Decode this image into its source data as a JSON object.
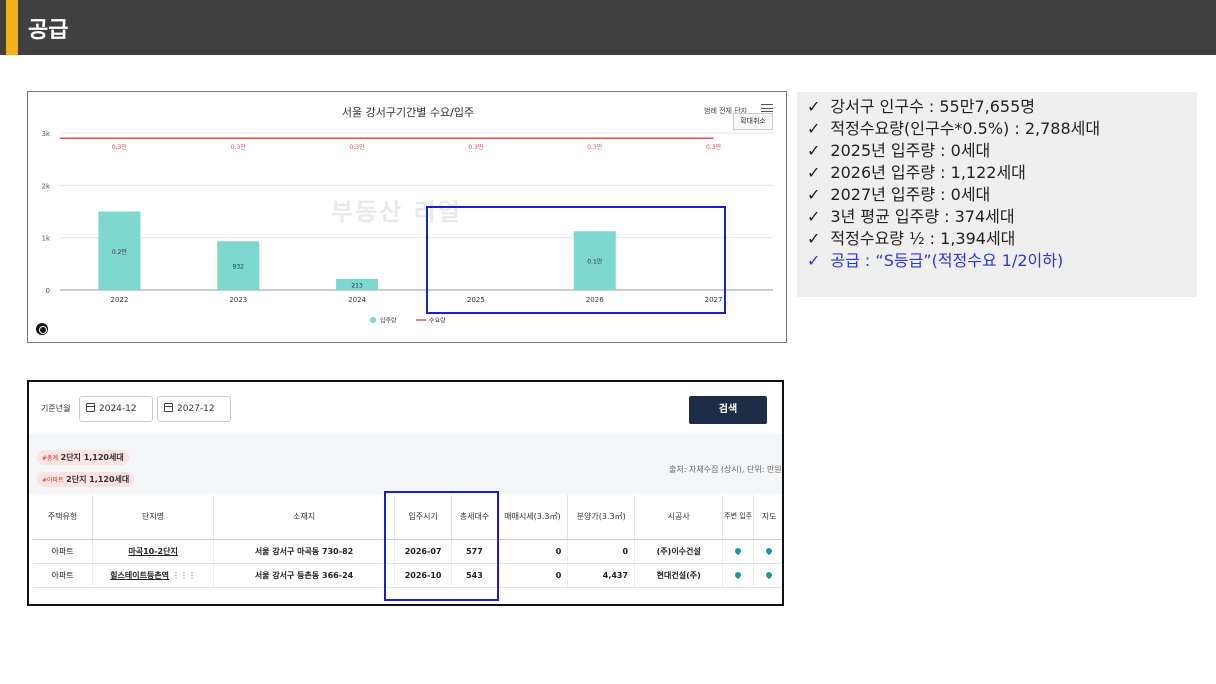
{
  "header": {
    "title": "공급"
  },
  "chart_data": {
    "type": "bar",
    "title": "서울 강서구기간별 수요/입주",
    "categories": [
      "2022",
      "2023",
      "2024",
      "2025",
      "2026",
      "2027"
    ],
    "series": [
      {
        "name": "입주량",
        "type": "bar",
        "values": [
          1500,
          932,
          213,
          0,
          1122,
          0
        ],
        "labels": [
          "0.2만",
          "932",
          "213",
          "",
          "0.1만",
          ""
        ],
        "color": "#7fd8d0"
      },
      {
        "name": "수요량",
        "type": "line",
        "values": [
          2900,
          2900,
          2900,
          2900,
          2900,
          2900
        ],
        "labels": [
          "0.3만",
          "0.3만",
          "0.3만",
          "0.3만",
          "0.3만",
          "0.3만"
        ],
        "color": "#e05252"
      }
    ],
    "y_ticks": [
      "0",
      "1k",
      "2k",
      "3k"
    ],
    "ylim": [
      0,
      3000
    ],
    "legend_position": "bottom",
    "grid": true
  },
  "chart_ui": {
    "top_right_label": "범례 전체 단지",
    "zoom_button": "확대취소",
    "watermark": "부동산 리얼"
  },
  "info": {
    "check": "✓",
    "lines": [
      "강서구 인구수 : 55만7,655명",
      "적정수요량(인구수*0.5%) : 2,788세대",
      "2025년 입주량 : 0세대",
      "2026년 입주량 : 1,122세대",
      "2027년 입주량 : 0세대",
      "3년 평균 입주량 : 374세대",
      "적정수요량 ½ : 1,394세대"
    ],
    "highlight_line": "공급 : “S등급”(적정수요 1/2이하)",
    "highlight_color": "#2a36e6"
  },
  "table_panel": {
    "filter_label": "기준년월",
    "date_from": "2024-12",
    "date_to": "2027-12",
    "search_button": "검색",
    "badge1_prefix": "#총계",
    "badge1_value": "2단지 1,120세대",
    "badge2_prefix": "#아파트",
    "badge2_value": "2단지 1,120세대",
    "source_note": "출처: 자체수집 (상시), 단위: 만원",
    "headers": {
      "type": "주택유형",
      "name": "단지명",
      "address": "소재지",
      "move_in": "입주시기",
      "households": "총세대수",
      "sale_price": "매매시세(3.3㎡)",
      "presale_price": "분양가(3.3㎡)",
      "builder": "시공사",
      "nearby": "주변 입주",
      "map": "지도"
    },
    "rows": [
      {
        "type": "아파트",
        "name": "마곡10-2단지",
        "address": "서울 강서구 마곡동 730-82",
        "move_in": "2026-07",
        "households": "577",
        "sale_price": "0",
        "presale_price": "0",
        "builder": "(주)이수건설"
      },
      {
        "type": "아파트",
        "name": "힐스테이트등촌역",
        "address": "서울 강서구 등촌동 366-24",
        "move_in": "2026-10",
        "households": "543",
        "sale_price": "0",
        "presale_price": "4,437",
        "builder": "현대건설(주)"
      }
    ]
  },
  "accent_color": "#f3b11c",
  "highlight_box_color": "#1b1fcf"
}
